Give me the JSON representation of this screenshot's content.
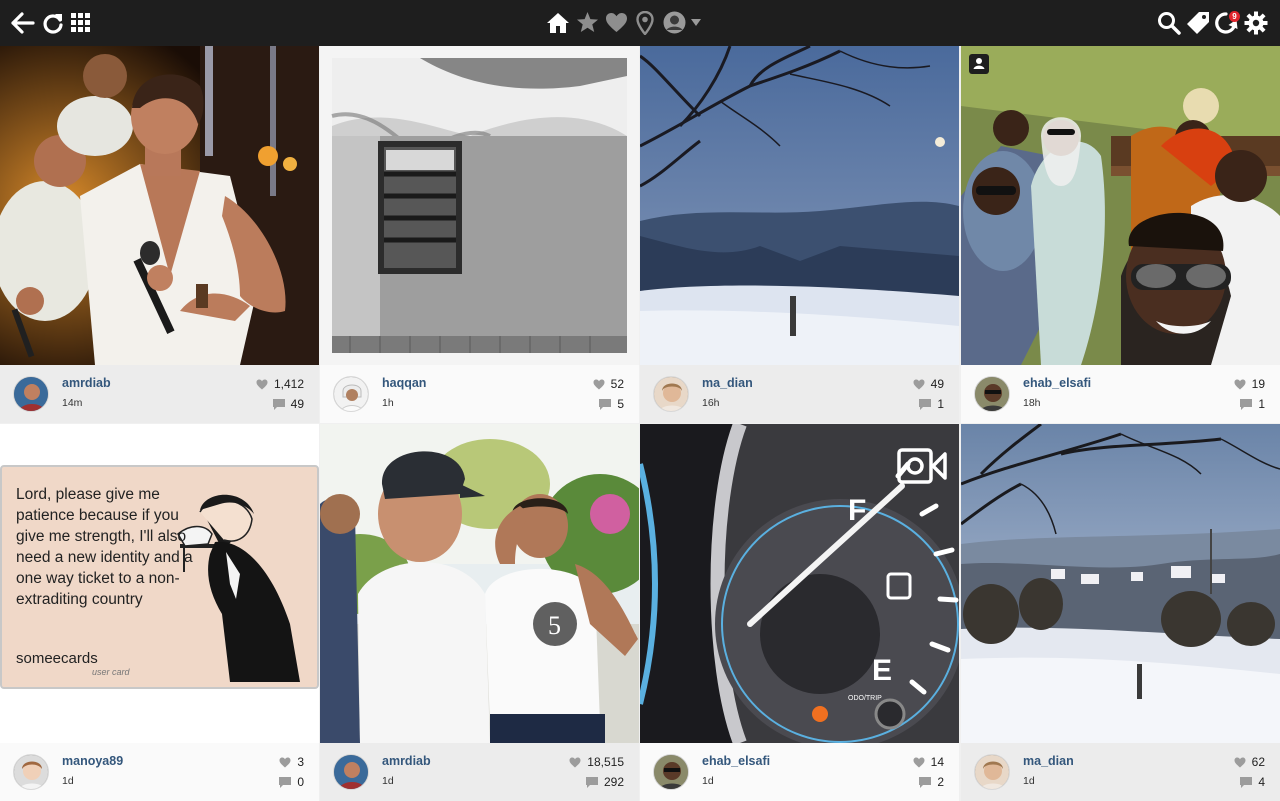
{
  "topbar": {
    "left_icons": [
      "back-arrow-icon",
      "refresh-icon",
      "grid-menu-icon"
    ],
    "center_icons": [
      "home-icon",
      "star-icon",
      "heart-icon",
      "location-pin-icon",
      "user-avatar-icon",
      "dropdown-caret-icon"
    ],
    "right_icons": [
      "search-icon",
      "tag-icon",
      "notifications-icon",
      "settings-gear-icon"
    ],
    "notification_count": "9",
    "background": "#1e1e1e"
  },
  "posts": [
    {
      "username": "amrdiab",
      "time": "14m",
      "likes": "1,412",
      "comments": "49"
    },
    {
      "username": "haqqan",
      "time": "1h",
      "likes": "52",
      "comments": "5"
    },
    {
      "username": "ma_dian",
      "time": "16h",
      "likes": "49",
      "comments": "1"
    },
    {
      "username": "ehab_elsafi",
      "time": "18h",
      "likes": "19",
      "comments": "1"
    },
    {
      "username": "manoya89",
      "time": "1d",
      "likes": "3",
      "comments": "0"
    },
    {
      "username": "amrdiab",
      "time": "1d",
      "likes": "18,515",
      "comments": "292"
    },
    {
      "username": "ehab_elsafi",
      "time": "1d",
      "likes": "14",
      "comments": "2"
    },
    {
      "username": "ma_dian",
      "time": "1d",
      "likes": "62",
      "comments": "4"
    }
  ],
  "ecard": {
    "text": "Lord, please give me patience because if you give me strength, I'll also need a new identity and a one way ticket to a non-extraditing country",
    "brand": "someecards",
    "sub": "user card"
  },
  "colors": {
    "username": "#34577c",
    "badge": "#e0242c"
  }
}
